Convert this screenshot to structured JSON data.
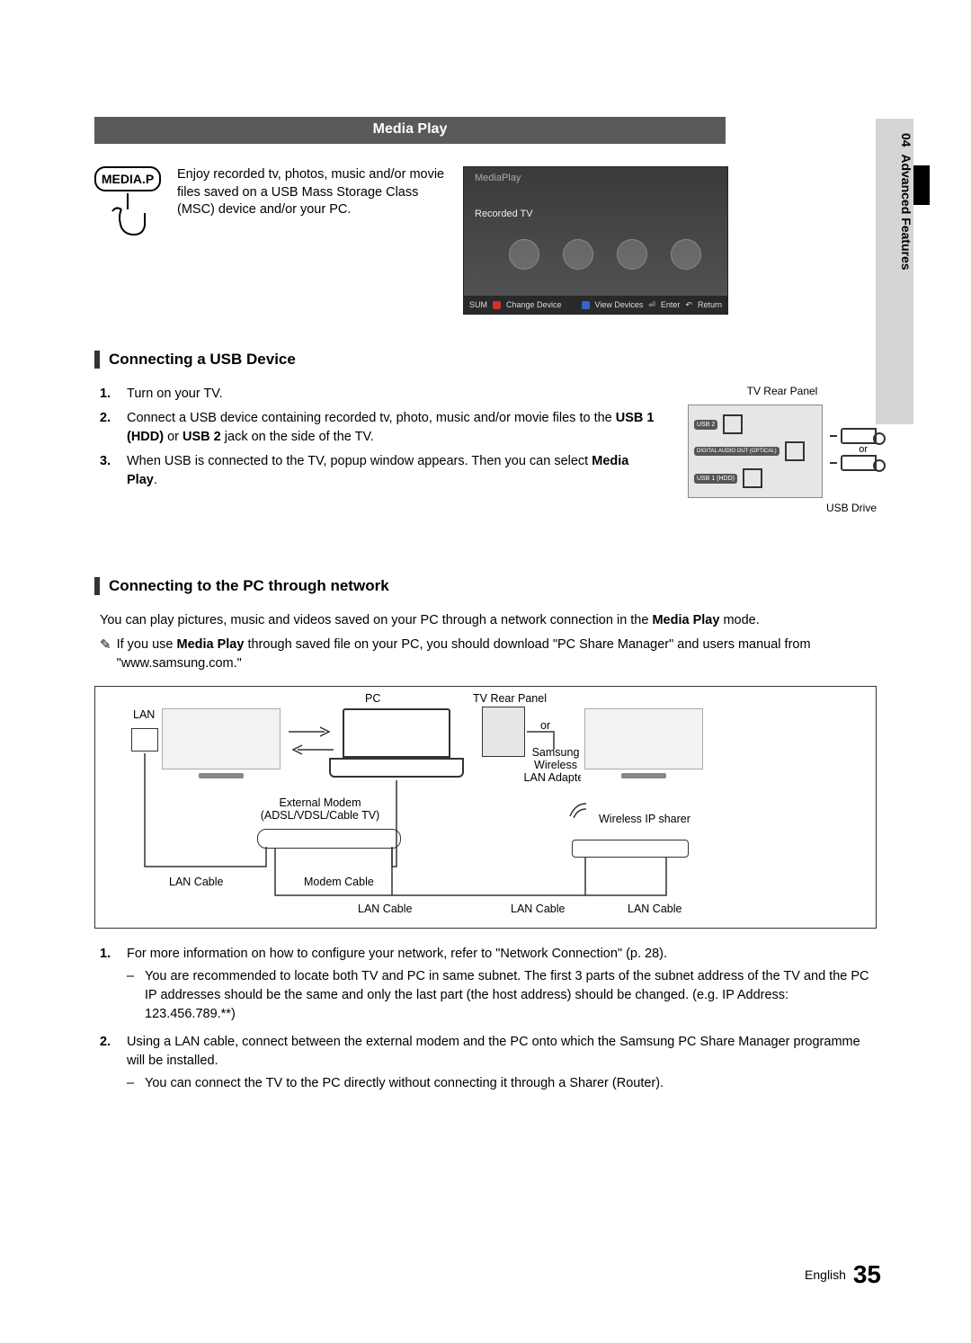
{
  "sidebar": {
    "chapter_num": "04",
    "chapter_title": "Advanced Features"
  },
  "title": "Media Play",
  "mediap_button": "MEDIA.P",
  "intro": "Enjoy recorded tv, photos, music and/or movie files saved on a USB Mass Storage Class (MSC) device and/or your PC.",
  "screenshot": {
    "top": "MediaPlay",
    "row": "Recorded TV",
    "bottom_sum": "SUM",
    "bottom_a": "Change Device",
    "bottom_d": "View Devices",
    "bottom_enter": "Enter",
    "bottom_return": "Return"
  },
  "sec1": {
    "heading": "Connecting a USB Device",
    "steps": [
      "Turn on your TV.",
      "Connect a USB device containing recorded tv, photo, music and/or movie files to the USB 1 (HDD) or USB 2 jack on the side of the TV.",
      "When USB is connected to the TV, popup window appears. Then you can select Media Play."
    ],
    "panel": {
      "title": "TV Rear Panel",
      "usb2": "USB 2",
      "audio": "DIGITAL AUDIO OUT (OPTICAL)",
      "usb1": "USB 1 (HDD)",
      "or": "or",
      "drive": "USB Drive"
    }
  },
  "sec2": {
    "heading": "Connecting to the PC through network",
    "intro": "You can play pictures, music and videos saved on your PC through a network connection in the Media Play mode.",
    "note": "If you use Media Play through saved file on your PC, you should download \"PC Share Manager\" and users manual from \"www.samsung.com.\"",
    "labels": {
      "lan": "LAN",
      "pc": "PC",
      "tv_rear": "TV Rear Panel",
      "or": "or",
      "samsung_adapter": "Samsung Wireless LAN Adapter",
      "ext_modem": "External Modem",
      "ext_modem2": "(ADSL/VDSL/Cable TV)",
      "wireless_sharer": "Wireless IP sharer",
      "lan_cable": "LAN Cable",
      "modem_cable": "Modem Cable"
    },
    "list": [
      {
        "text": "For more information on how to configure your network, refer to \"Network Connection\" (p. 28).",
        "subs": [
          "You are recommended to locate both TV and PC in same subnet. The first 3 parts of the subnet address of the TV and the PC IP addresses should be the same and only the last part (the host address) should be changed. (e.g. IP Address: 123.456.789.**)"
        ]
      },
      {
        "text": "Using a LAN cable, connect between the external modem and the PC onto which the Samsung PC Share Manager programme will be installed.",
        "subs": [
          "You can connect the TV to the PC directly without connecting it through a Sharer (Router)."
        ]
      }
    ]
  },
  "footer": {
    "lang": "English",
    "page": "35"
  }
}
